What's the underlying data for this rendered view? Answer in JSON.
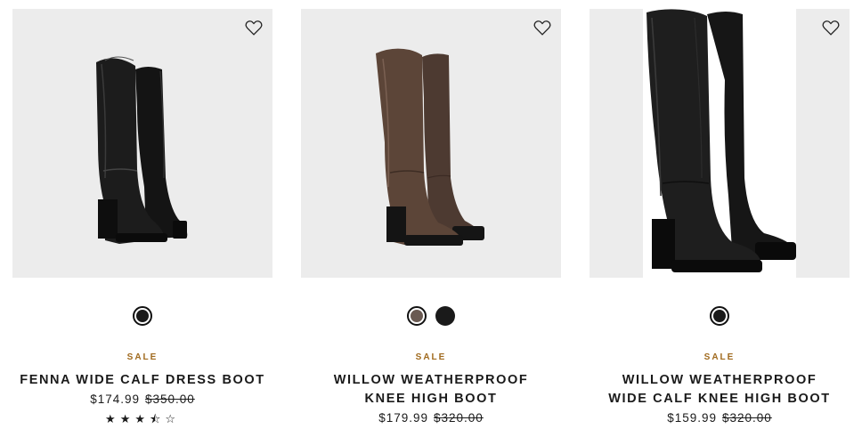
{
  "products": [
    {
      "badge": "SALE",
      "name": "FENNA WIDE CALF DRESS BOOT",
      "price": "$174.99",
      "original_price": "$350.00",
      "rating": 3.5,
      "stars": [
        "★",
        "★",
        "★",
        "⯪",
        "☆"
      ],
      "colors": [
        "#1a1a1a"
      ],
      "selected_color": 0,
      "image_icon": "knee-high-boot-black"
    },
    {
      "badge": "SALE",
      "name": "WILLOW WEATHERPROOF KNEE HIGH BOOT",
      "price": "$179.99",
      "original_price": "$320.00",
      "colors": [
        "#5c4a40",
        "#1a1a1a"
      ],
      "selected_color": 0,
      "image_icon": "knee-high-boot-brown"
    },
    {
      "badge": "SALE",
      "name": "WILLOW WEATHERPROOF WIDE CALF KNEE HIGH BOOT",
      "price": "$159.99",
      "original_price": "$320.00",
      "colors": [
        "#1a1a1a"
      ],
      "selected_color": 0,
      "image_icon": "knee-high-boot-black"
    }
  ],
  "icons": {
    "wishlist": "heart-outline-icon"
  },
  "colors": {
    "sale": "#a06a1e",
    "text": "#1a1a1a",
    "image_bg": "#ececec"
  }
}
